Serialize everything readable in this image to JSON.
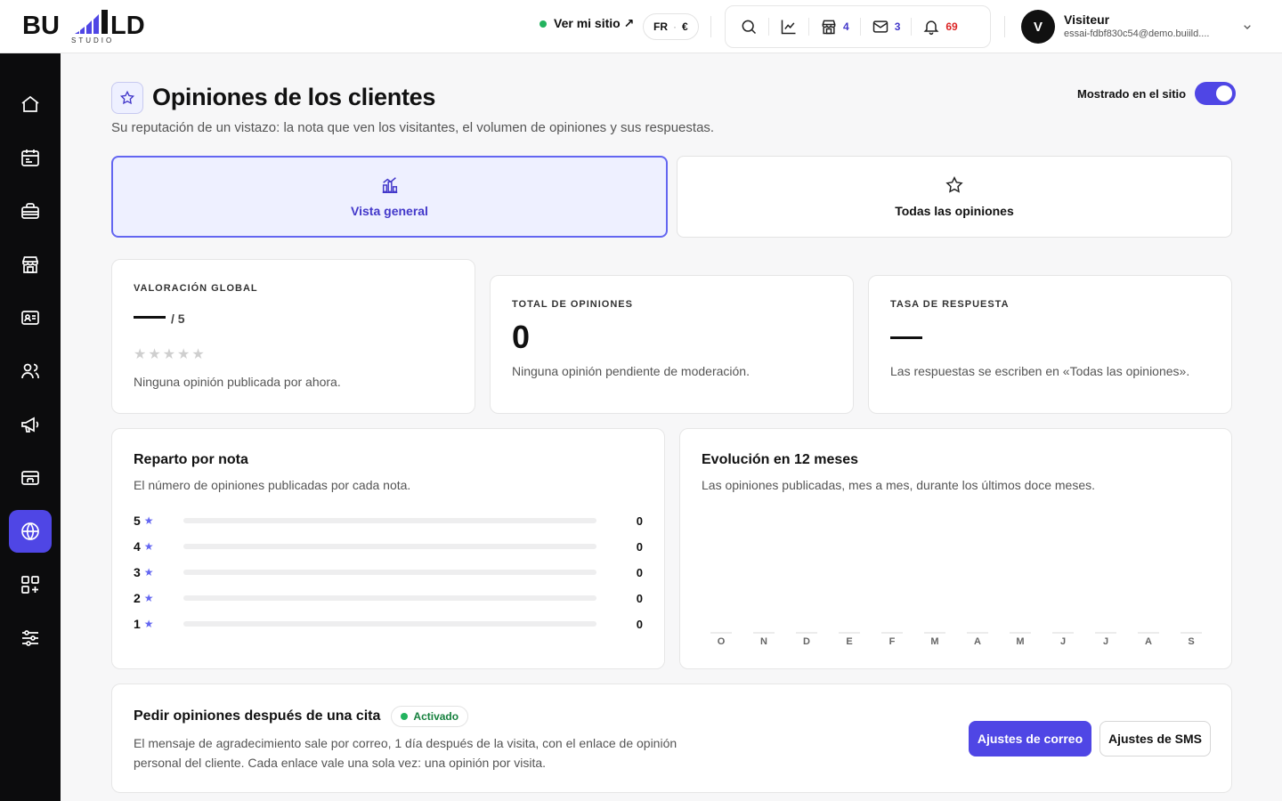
{
  "brand": {
    "name": "BUILD",
    "tagline": "STUDIO"
  },
  "header": {
    "site_link": "Ver mi sitio ↗",
    "lang": "FR",
    "currency": "€",
    "tools": {
      "shop_count": "4",
      "mail_count": "3",
      "notif_count": "69"
    },
    "user": {
      "initial": "V",
      "name": "Visiteur",
      "email": "essai-fdbf830c54@demo.buiild...."
    }
  },
  "sidebar": {
    "items": [
      "home-icon",
      "calendar-icon",
      "briefcase-icon",
      "store-icon",
      "contact-card-icon",
      "users-icon",
      "megaphone-icon",
      "payment-icon",
      "globe-icon",
      "apps-icon",
      "settings-sliders-icon"
    ],
    "active": "globe-icon"
  },
  "page": {
    "title": "Opiniones de los clientes",
    "subtitle": "Su reputación de un vistazo: la nota que ven los visitantes, el volumen de opiniones y sus respuestas.",
    "toggle_label": "Mostrado en el sitio",
    "toggle_on": true
  },
  "tabs": [
    {
      "label": "Vista general",
      "active": true
    },
    {
      "label": "Todas las opiniones",
      "active": false
    }
  ],
  "kpis": {
    "global": {
      "label": "VALORACIÓN GLOBAL",
      "value": "",
      "scale": "/ 5",
      "stars_filled": 0,
      "desc": "Ninguna opinión publicada por ahora."
    },
    "total": {
      "label": "TOTAL DE OPINIONES",
      "value": "0",
      "desc": "Ninguna opinión pendiente de moderación."
    },
    "response": {
      "label": "TASA DE RESPUESTA",
      "value": "",
      "desc": "Las respuestas se escriben en «Todas las opiniones»."
    }
  },
  "distribution": {
    "title": "Reparto por nota",
    "subtitle": "El número de opiniones publicadas por cada nota.",
    "rows": [
      {
        "label": "5",
        "value": 0
      },
      {
        "label": "4",
        "value": 0
      },
      {
        "label": "3",
        "value": 0
      },
      {
        "label": "2",
        "value": 0
      },
      {
        "label": "1",
        "value": 0
      }
    ]
  },
  "evolution": {
    "title": "Evolución en 12 meses",
    "subtitle": "Las opiniones publicadas, mes a mes, durante los últimos doce meses."
  },
  "chart_data": {
    "type": "bar",
    "categories": [
      "O",
      "N",
      "D",
      "E",
      "F",
      "M",
      "A",
      "M",
      "J",
      "J",
      "A",
      "S"
    ],
    "values": [
      0,
      0,
      0,
      0,
      0,
      0,
      0,
      0,
      0,
      0,
      0,
      0
    ],
    "title": "Evolución en 12 meses",
    "xlabel": "",
    "ylabel": "",
    "grid": false
  },
  "request": {
    "title": "Pedir opiniones después de una cita",
    "status": "Activado",
    "text_line1": "El mensaje de agradecimiento sale por correo, 1 día después de la visita, con el enlace de opinión",
    "text_line2": "personal del cliente. Cada enlace vale una sola vez: una opinión por visita.",
    "btn_email": "Ajustes de correo",
    "btn_sms": "Ajustes de SMS"
  },
  "colors": {
    "accent": "#4f46e5",
    "accent_light": "#eef0ff",
    "success": "#22b35e",
    "alert": "#dc2626",
    "sidebar_bg": "#0c0c0d"
  }
}
